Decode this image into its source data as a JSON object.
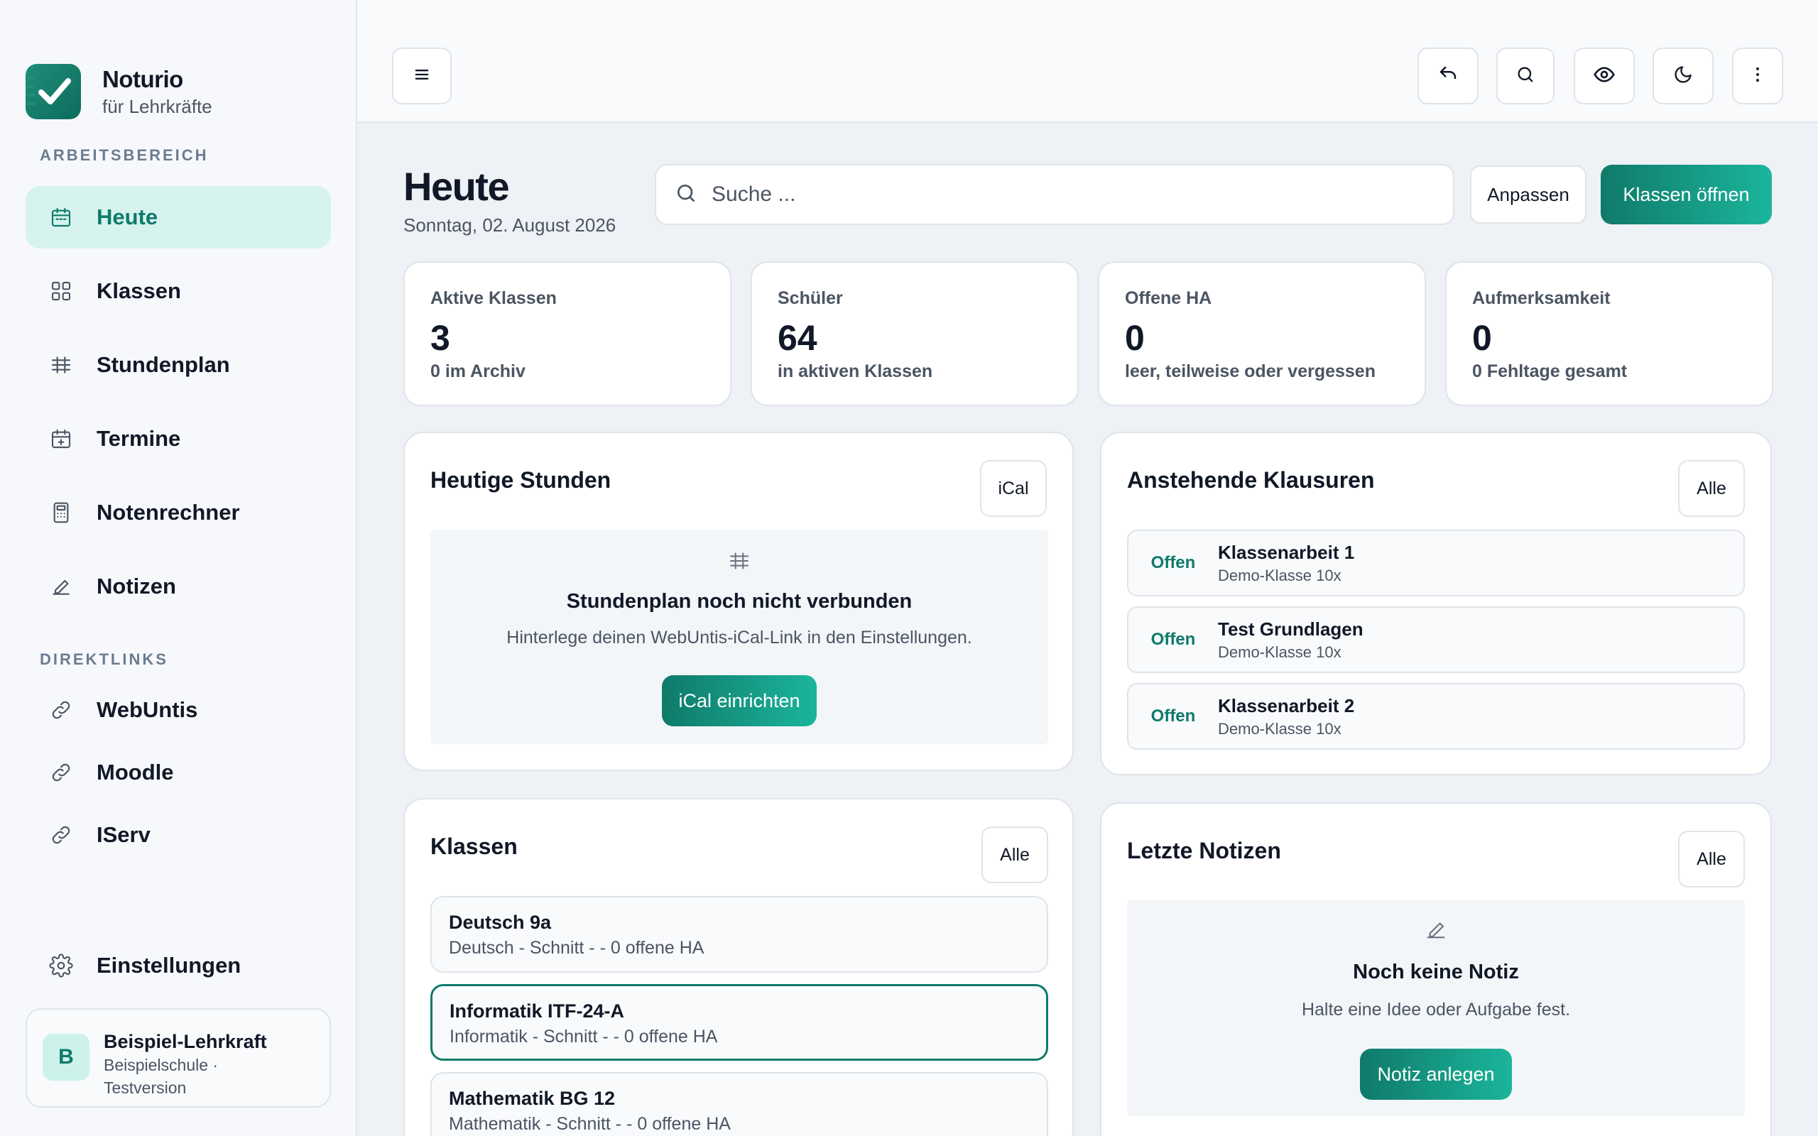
{
  "app": {
    "name": "Noturio",
    "subtitle": "für Lehrkräfte",
    "accent_color": "#0f7a6a"
  },
  "sidebar": {
    "workspace_label": "ARBEITSBEREICH",
    "nav": [
      {
        "label": "Heute",
        "icon": "calendar-icon",
        "active": true
      },
      {
        "label": "Klassen",
        "icon": "grid-icon"
      },
      {
        "label": "Stundenplan",
        "icon": "timetable-icon"
      },
      {
        "label": "Termine",
        "icon": "calendar-plus-icon"
      },
      {
        "label": "Notenrechner",
        "icon": "calculator-icon"
      },
      {
        "label": "Notizen",
        "icon": "pencil-icon"
      }
    ],
    "links_label": "DIREKTLINKS",
    "links": [
      {
        "label": "WebUntis",
        "icon": "link-icon"
      },
      {
        "label": "Moodle",
        "icon": "link-icon"
      },
      {
        "label": "IServ",
        "icon": "link-icon"
      }
    ],
    "settings_label": "Einstellungen",
    "user": {
      "initial": "B",
      "name": "Beispiel-Lehrkraft",
      "school": "Beispielschule ·",
      "version": "Testversion"
    }
  },
  "topbar": {
    "icons": [
      "menu-icon",
      "undo-icon",
      "search-icon",
      "eye-icon",
      "moon-icon",
      "more-vertical-icon"
    ]
  },
  "header": {
    "title": "Heute",
    "date": "Sonntag, 02. August 2026",
    "search_placeholder": "Suche ...",
    "customize_label": "Anpassen",
    "open_classes_label": "Klassen öffnen"
  },
  "stats": [
    {
      "label": "Aktive Klassen",
      "value": "3",
      "sub": "0 im Archiv"
    },
    {
      "label": "Schüler",
      "value": "64",
      "sub": "in aktiven Klassen"
    },
    {
      "label": "Offene HA",
      "value": "0",
      "sub": "leer, teilweise oder vergessen"
    },
    {
      "label": "Aufmerksamkeit",
      "value": "0",
      "sub": "0 Fehltage gesamt"
    }
  ],
  "today_lessons": {
    "title": "Heutige Stunden",
    "button": "iCal",
    "empty_title": "Stundenplan noch nicht verbunden",
    "empty_text": "Hinterlege deinen WebUntis-iCal-Link in den Einstellungen.",
    "action": "iCal einrichten"
  },
  "exams": {
    "title": "Anstehende Klausuren",
    "button": "Alle",
    "items": [
      {
        "status": "Offen",
        "name": "Klassenarbeit 1",
        "class": "Demo-Klasse 10x"
      },
      {
        "status": "Offen",
        "name": "Test Grundlagen",
        "class": "Demo-Klasse 10x"
      },
      {
        "status": "Offen",
        "name": "Klassenarbeit 2",
        "class": "Demo-Klasse 10x"
      }
    ]
  },
  "classes": {
    "title": "Klassen",
    "button": "Alle",
    "items": [
      {
        "name": "Deutsch 9a",
        "sub": "Deutsch - Schnitt - - 0 offene HA"
      },
      {
        "name": "Informatik ITF-24-A",
        "sub": "Informatik - Schnitt - - 0 offene HA",
        "selected": true
      },
      {
        "name": "Mathematik BG 12",
        "sub": "Mathematik - Schnitt - - 0 offene HA"
      }
    ]
  },
  "notes": {
    "title": "Letzte Notizen",
    "button": "Alle",
    "empty_title": "Noch keine Notiz",
    "empty_text": "Halte eine Idee oder Aufgabe fest.",
    "action": "Notiz anlegen"
  }
}
